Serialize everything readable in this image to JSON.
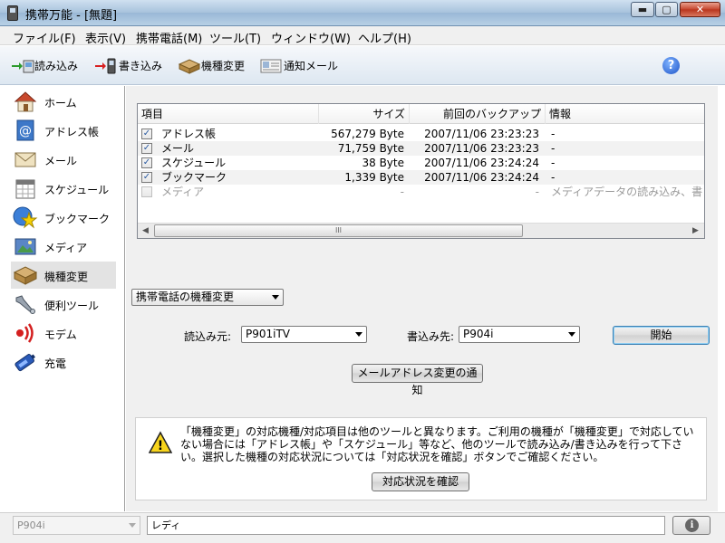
{
  "window": {
    "title": "携帯万能  - [無題]",
    "buttons": {
      "minimize": "▬",
      "maximize": "▢",
      "close": "✕"
    }
  },
  "menu": [
    "ファイル(F)",
    "表示(V)",
    "携帯電話(M)",
    "ツール(T)",
    "ウィンドウ(W)",
    "ヘルプ(H)"
  ],
  "toolbar": {
    "read": "読み込み",
    "write": "書き込み",
    "model_change": "機種変更",
    "notify_mail": "通知メール",
    "help_glyph": "?"
  },
  "sidebar": {
    "items": [
      {
        "label": "ホーム",
        "icon": "home-icon"
      },
      {
        "label": "アドレス帳",
        "icon": "address-book-icon"
      },
      {
        "label": "メール",
        "icon": "mail-icon"
      },
      {
        "label": "スケジュール",
        "icon": "calendar-icon"
      },
      {
        "label": "ブックマーク",
        "icon": "bookmark-icon"
      },
      {
        "label": "メディア",
        "icon": "media-icon"
      },
      {
        "label": "機種変更",
        "icon": "model-change-icon"
      },
      {
        "label": "便利ツール",
        "icon": "tools-icon"
      },
      {
        "label": "モデム",
        "icon": "modem-icon"
      },
      {
        "label": "充電",
        "icon": "charge-icon"
      }
    ],
    "selected_index": 6
  },
  "table": {
    "columns": [
      "項目",
      "サイズ",
      "前回のバックアップ",
      "情報"
    ],
    "rows": [
      {
        "checked": true,
        "name": "アドレス帳",
        "size": "567,279 Byte",
        "backup": "2007/11/06 23:23:23",
        "info": "-"
      },
      {
        "checked": true,
        "name": "メール",
        "size": "71,759 Byte",
        "backup": "2007/11/06 23:23:23",
        "info": "-"
      },
      {
        "checked": true,
        "name": "スケジュール",
        "size": "38 Byte",
        "backup": "2007/11/06 23:24:24",
        "info": "-"
      },
      {
        "checked": true,
        "name": "ブックマーク",
        "size": "1,339 Byte",
        "backup": "2007/11/06 23:24:24",
        "info": "-"
      },
      {
        "checked": false,
        "name": "メディア",
        "size": "-",
        "backup": "-",
        "info": "メディアデータの読み込み、書き込"
      }
    ],
    "check_glyph": "✓",
    "scroll": {
      "left": "◀",
      "right": "▶",
      "thumb_grip": "III"
    }
  },
  "mode_select": "携帯電話の機種変更",
  "source": {
    "label": "読込み元:",
    "value": "P901iTV"
  },
  "target": {
    "label": "書込み先:",
    "value": "P904i"
  },
  "start_button": "開始",
  "notify_button": "メールアドレス変更の通知",
  "notice": {
    "text": "「機種変更」の対応機種/対応項目は他のツールと異なります。ご利用の機種が「機種変更」で対応していない場合には「アドレス帳」や「スケジュール」等など、他のツールで読み込み/書き込みを行って下さい。選択した機種の対応状況については「対応状況を確認」ボタンでご確認ください。",
    "check_button": "対応状況を確認",
    "warn_glyph": "!"
  },
  "status": {
    "device": "P904i",
    "text": "レディ",
    "info_glyph": "i"
  }
}
